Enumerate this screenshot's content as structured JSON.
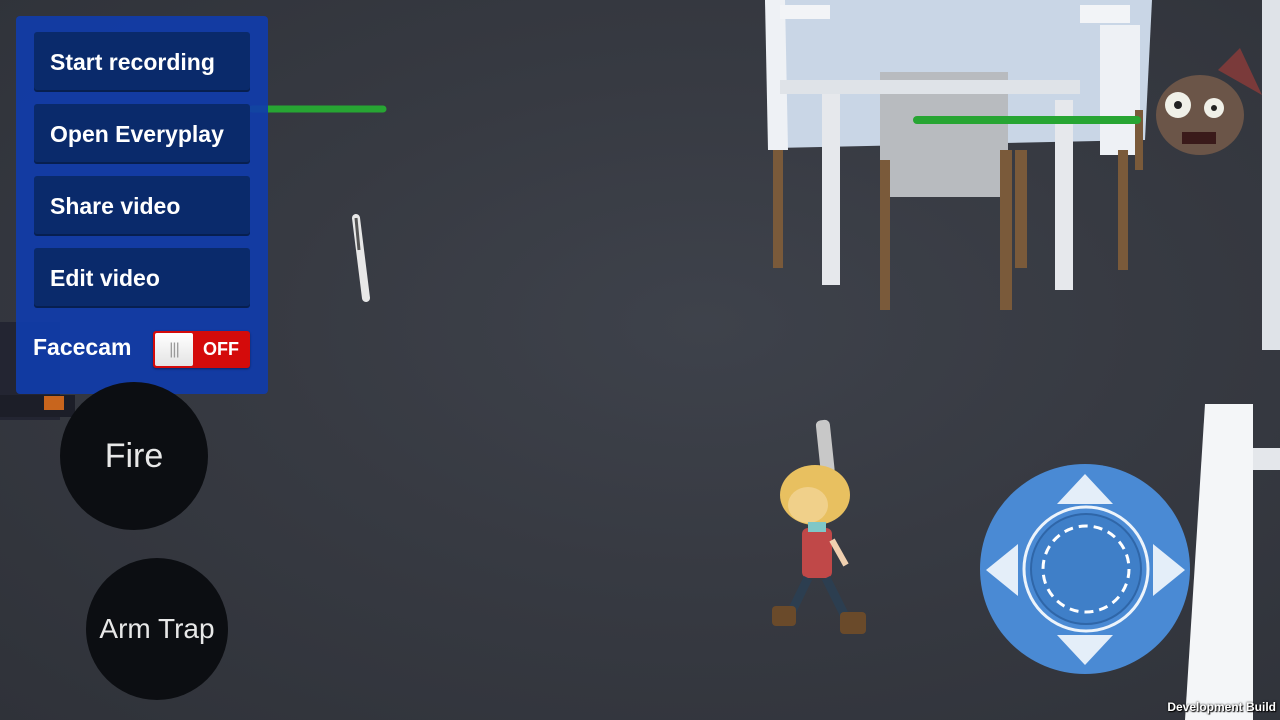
{
  "everyplay_menu": {
    "start_recording_label": "Start recording",
    "open_everyplay_label": "Open Everyplay",
    "share_video_label": "Share video",
    "edit_video_label": "Edit video",
    "facecam_label": "Facecam",
    "facecam_toggle_text": "OFF",
    "facecam_enabled": false
  },
  "controls": {
    "fire_label": "Fire",
    "arm_trap_label": "Arm Trap",
    "joystick_icon": "dpad-joystick-icon"
  },
  "footer": {
    "build_label": "Development Build"
  },
  "colors": {
    "panel_blue": "#1a45b0",
    "button_navy": "#0a2a6b",
    "toggle_red": "#d40b0b",
    "health_green": "#2fb93a",
    "joystick_blue": "#4a8ad4"
  }
}
